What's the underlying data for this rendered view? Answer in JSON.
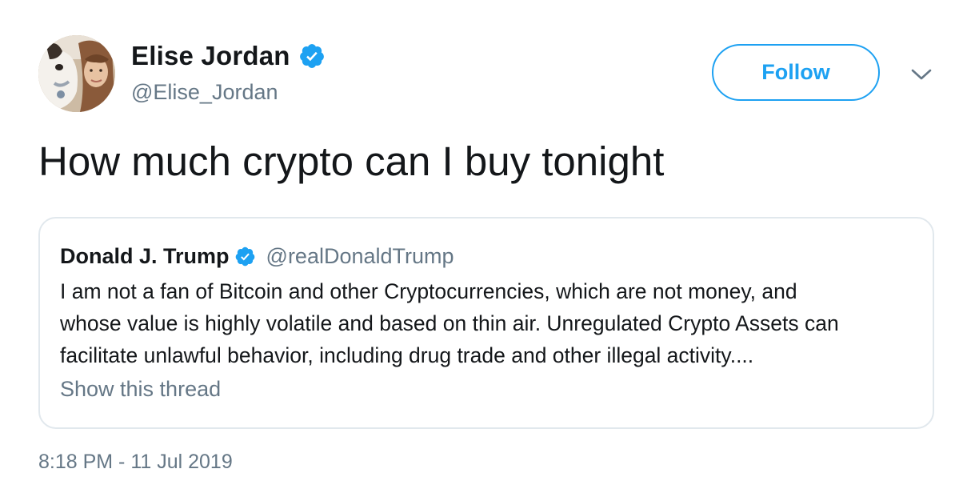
{
  "author": {
    "display_name": "Elise Jordan",
    "handle": "@Elise_Jordan",
    "verified": true
  },
  "follow_button": {
    "label": "Follow"
  },
  "more_menu": {
    "icon": "chevron-down-icon"
  },
  "tweet": {
    "text": "How much crypto can I buy tonight",
    "timestamp": "8:18 PM - 11 Jul 2019"
  },
  "quoted_tweet": {
    "author_name": "Donald J. Trump",
    "author_handle": "@realDonaldTrump",
    "verified": true,
    "lines": [
      "I am not a fan of Bitcoin and other Cryptocurrencies, which are not money, and",
      "whose value is highly volatile and based on thin air. Unregulated Crypto Assets can",
      "facilitate unlawful behavior, including drug trade and other illegal activity...."
    ],
    "show_thread": "Show this thread"
  },
  "colors": {
    "accent": "#1da1f2",
    "text_primary": "#14171a",
    "text_secondary": "#657786",
    "border": "#e1e8ed"
  }
}
